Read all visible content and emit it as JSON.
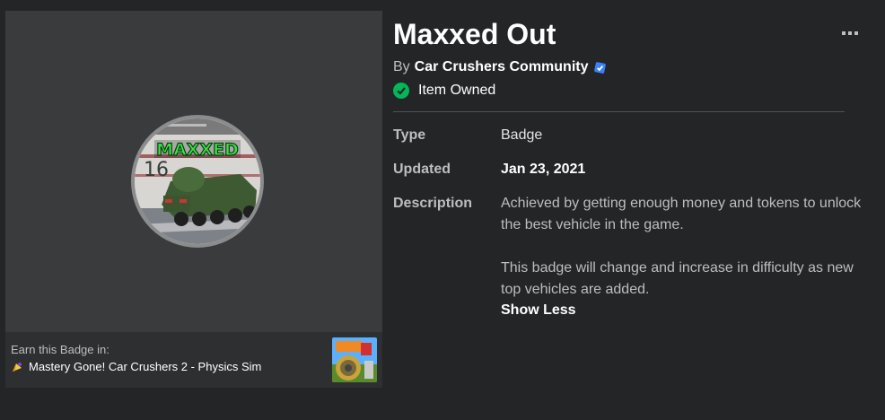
{
  "badge": {
    "title": "Maxxed Out",
    "creator_prefix": "By",
    "creator_name": "Car Crushers Community",
    "owned_status": "Item Owned",
    "image_text": "MAXXED",
    "image_number": "16"
  },
  "details": {
    "type_label": "Type",
    "type_value": "Badge",
    "updated_label": "Updated",
    "updated_value": "Jan 23, 2021",
    "description_label": "Description",
    "description_p1": "Achieved by getting enough money and tokens to unlock the best vehicle in the game.",
    "description_p2": "This badge will change and increase in difficulty as new top vehicles are added.",
    "show_less": "Show Less"
  },
  "earn": {
    "label": "Earn this Badge in:",
    "game_name": "Mastery Gone! Car Crushers 2 - Physics Sim"
  },
  "icons": {
    "more": "more-options-icon",
    "verified": "verified-badge-icon",
    "owned": "check-circle-icon",
    "mastery": "mastery-icon"
  },
  "colors": {
    "background": "#232527",
    "panel": "#393b3d",
    "owned_green": "#02b757",
    "verified_blue": "#3b82f6"
  }
}
